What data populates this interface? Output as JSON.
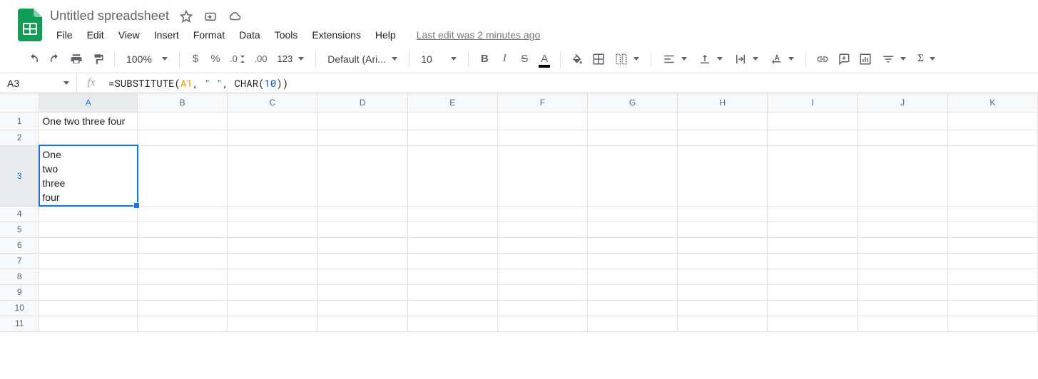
{
  "header": {
    "title": "Untitled spreadsheet",
    "last_edit": "Last edit was 2 minutes ago"
  },
  "menus": [
    "File",
    "Edit",
    "View",
    "Insert",
    "Format",
    "Data",
    "Tools",
    "Extensions",
    "Help"
  ],
  "toolbar": {
    "zoom": "100%",
    "font": "Default (Ari...",
    "font_size": "10"
  },
  "formula_bar": {
    "cell_ref": "A3",
    "formula_prefix": "=",
    "fn_name": "SUBSTITUTE",
    "open": "(",
    "arg_ref": "A1",
    "sep1": ", ",
    "arg_str": "\" \"",
    "sep2": ", ",
    "fn_char": "CHAR",
    "open2": "(",
    "arg_num": "10",
    "close": "))"
  },
  "columns": [
    "A",
    "B",
    "C",
    "D",
    "E",
    "F",
    "G",
    "H",
    "I",
    "J",
    "K"
  ],
  "rows": [
    "1",
    "2",
    "3",
    "4",
    "5",
    "6",
    "7",
    "8",
    "9",
    "10",
    "11"
  ],
  "selected": {
    "row": "3",
    "col": "A"
  },
  "cells": {
    "A1": "One two three four",
    "A3": "One\ntwo\nthree\nfour"
  }
}
